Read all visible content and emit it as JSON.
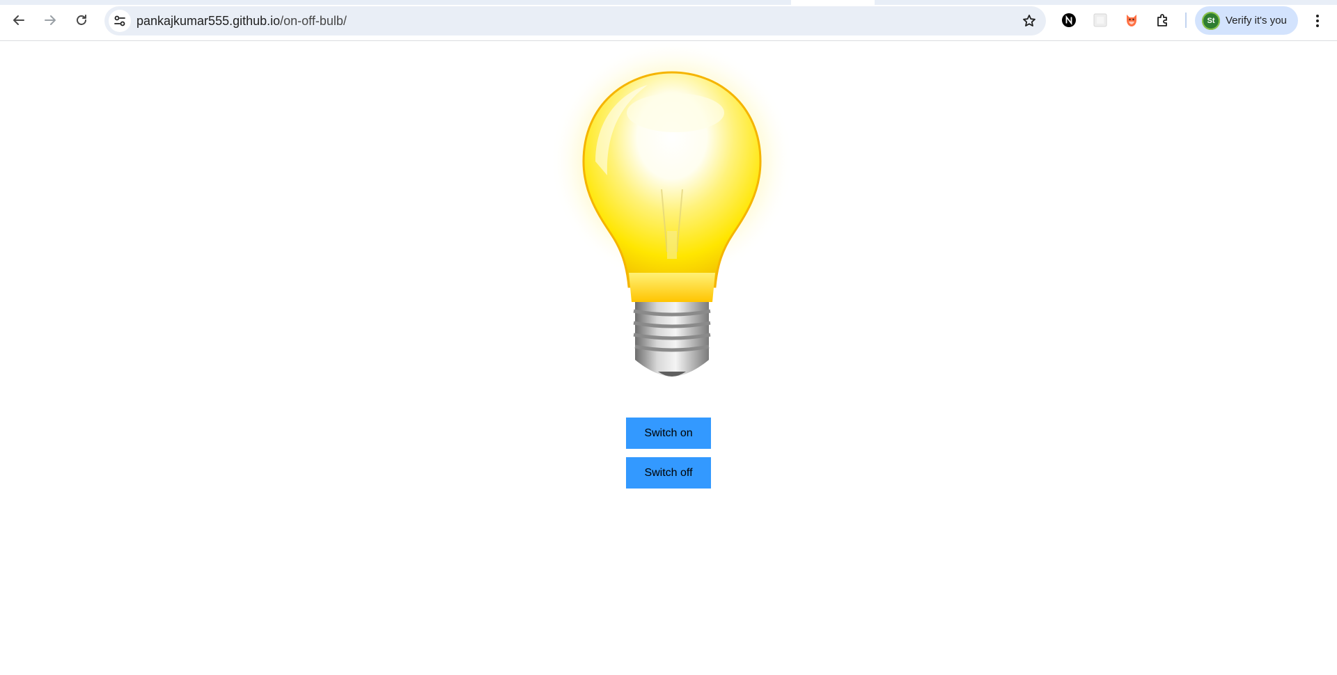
{
  "browser": {
    "url_host": "pankajkumar555.github.io",
    "url_path": "/on-off-bulb/",
    "profile_label": "Verify it's you",
    "profile_avatar_text": "St",
    "icons": {
      "back": "arrow-left-icon",
      "forward": "arrow-right-icon",
      "reload": "reload-icon",
      "site_info": "tune-icon",
      "bookmark": "star-icon",
      "extensions": [
        "notion-icon",
        "blank-extension-icon",
        "fox-extension-icon",
        "puzzle-icon"
      ],
      "menu": "more-vertical-icon"
    }
  },
  "page": {
    "bulb_state": "on",
    "buttons": {
      "switch_on": "Switch on",
      "switch_off": "Switch off"
    },
    "colors": {
      "button_bg": "#3399ff",
      "bulb_glow": "#fff59d",
      "bulb_glass": "#ffe600"
    }
  }
}
